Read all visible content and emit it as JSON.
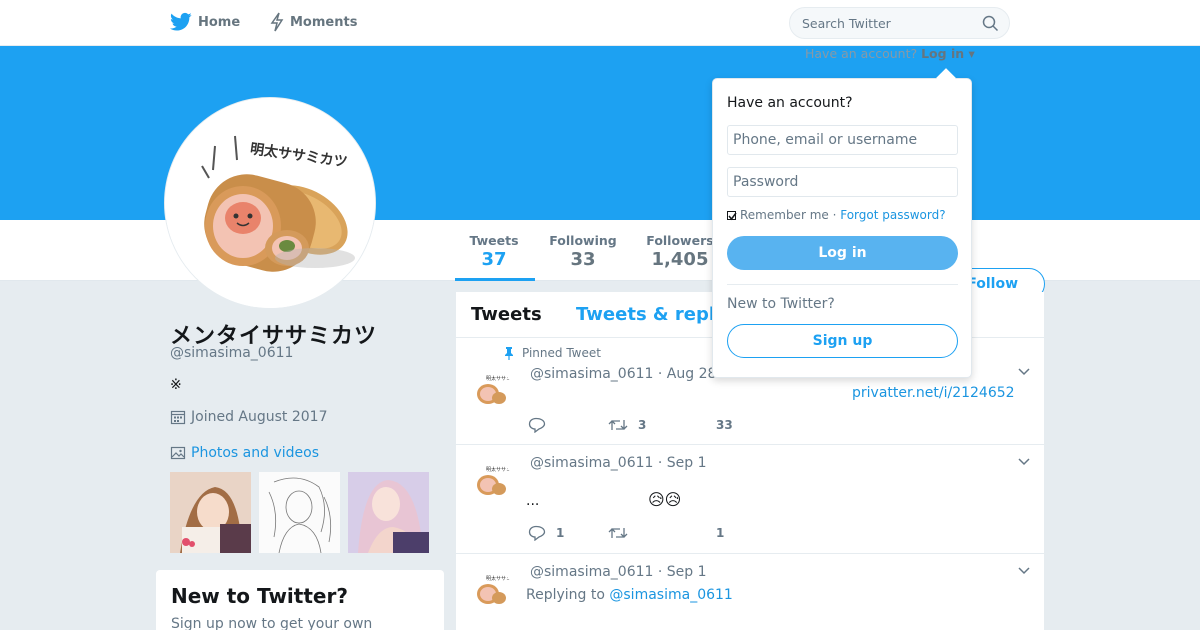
{
  "nav": {
    "home_label": "Home",
    "moments_label": "Moments",
    "search_placeholder": "Search Twitter"
  },
  "header": {
    "have_account_text": "Have an account?",
    "login_link": "Log in"
  },
  "profile": {
    "name": "メンタイササミカツ",
    "handle": "@simasima_0611",
    "bio": "※",
    "joined": "Joined August 2017",
    "photos_label": "Photos and videos"
  },
  "stats": {
    "tweets_label": "Tweets",
    "tweets_value": "37",
    "following_label": "Following",
    "following_value": "33",
    "followers_label": "Followers",
    "followers_value": "1,405"
  },
  "follow_button": "Follow",
  "timeline": {
    "tab_tweets": "Tweets",
    "tab_replies": "Tweets & repl",
    "pinned_label": "Pinned Tweet",
    "tweets": [
      {
        "header": "@simasima_0611 · Aug 28",
        "link": "privatter.net/i/2124652",
        "retweets": "3",
        "likes": "33"
      },
      {
        "header": "@simasima_0611 · Sep 1",
        "text": "...",
        "emoji": "😥😥",
        "replies": "1",
        "likes": "1"
      },
      {
        "header": "@simasima_0611 · Sep 1",
        "replying_to": "Replying to",
        "replying_handle": "@simasima_0611"
      }
    ]
  },
  "new_to_twitter": {
    "title": "New to Twitter?",
    "subtitle": "Sign up now to get your own"
  },
  "login_dropdown": {
    "title": "Have an account?",
    "username_placeholder": "Phone, email or username",
    "password_placeholder": "Password",
    "remember_me": "Remember me",
    "separator": " · ",
    "forgot_password": "Forgot password?",
    "login_button": "Log in",
    "new_to_twitter": "New to Twitter?",
    "signup_button": "Sign up"
  },
  "colors": {
    "brand_blue": "#1da1f2",
    "banner": "#1da1f2",
    "page_bg": "#e6ecf0"
  }
}
